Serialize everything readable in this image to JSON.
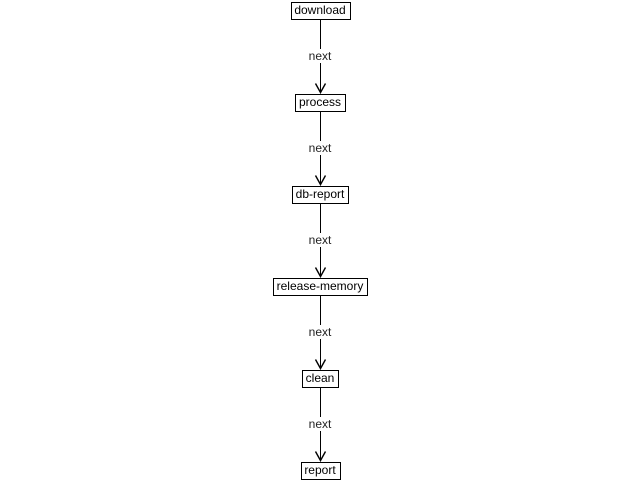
{
  "diagram": {
    "nodes": [
      {
        "id": "download",
        "label": "download",
        "highlighted": true
      },
      {
        "id": "process",
        "label": "process",
        "highlighted": false
      },
      {
        "id": "db-report",
        "label": "db-report",
        "highlighted": false
      },
      {
        "id": "release-memory",
        "label": "release-memory",
        "highlighted": false
      },
      {
        "id": "clean",
        "label": "clean",
        "highlighted": false
      },
      {
        "id": "report",
        "label": "report",
        "highlighted": false
      }
    ],
    "edges": [
      {
        "from": "download",
        "to": "process",
        "label": "next"
      },
      {
        "from": "process",
        "to": "db-report",
        "label": "next"
      },
      {
        "from": "db-report",
        "to": "release-memory",
        "label": "next"
      },
      {
        "from": "release-memory",
        "to": "clean",
        "label": "next"
      },
      {
        "from": "clean",
        "to": "report",
        "label": "next"
      }
    ],
    "colors": {
      "highlight_fill": "#33ee33",
      "node_fill": "#ffffff",
      "stroke": "#000000"
    }
  }
}
